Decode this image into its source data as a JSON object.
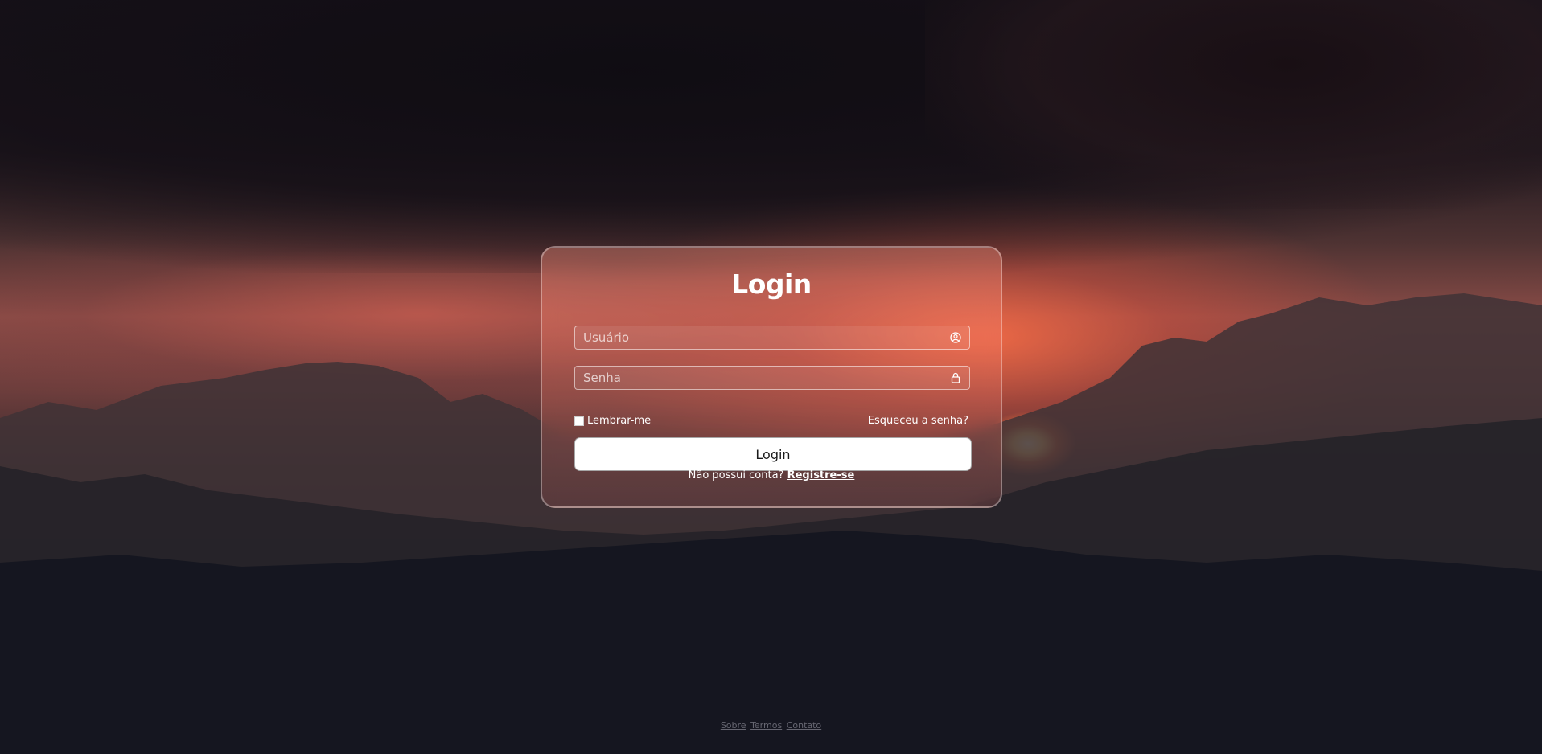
{
  "login": {
    "title": "Login",
    "username_placeholder": "Usuário",
    "password_placeholder": "Senha",
    "remember_label": "Lembrar-me",
    "forgot_link": "Esqueceu a senha?",
    "submit_label": "Login",
    "no_account_text": "Não possui conta?",
    "register_link": "Registre-se"
  },
  "footer": {
    "links": [
      "Sobre",
      "Termos",
      "Contato"
    ]
  },
  "icons": {
    "username": "user-circle-icon",
    "password": "lock-icon"
  },
  "colors": {
    "card_border": "#ffffff",
    "button_bg": "#ffffff",
    "text": "#ffffff"
  }
}
